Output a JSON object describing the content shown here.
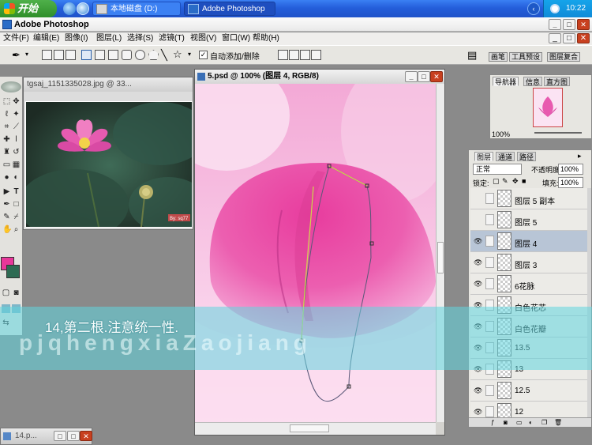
{
  "taskbar": {
    "start_label": "开始",
    "tasks": [
      {
        "label": "本地磁盘 (D:)"
      },
      {
        "label": "Adobe Photoshop"
      }
    ],
    "clock": "10:22"
  },
  "app": {
    "title": "Adobe Photoshop"
  },
  "menu": [
    "文件(F)",
    "编辑(E)",
    "图像(I)",
    "图层(L)",
    "选择(S)",
    "滤镜(T)",
    "视图(V)",
    "窗口(W)",
    "帮助(H)"
  ],
  "options": {
    "auto_add_delete": "自动添加/删除",
    "auto_add_checked": "✓",
    "palette_tabs": [
      "画笔",
      "工具预设",
      "图层复合"
    ]
  },
  "documents": {
    "photo_title": "tgsaj_1151335028.jpg @ 33...",
    "photo_watermark": "By: sq77",
    "main_title": "5.psd @ 100% (图层 4, RGB/8)",
    "minimized_title": "14.p..."
  },
  "navigator": {
    "tabs": [
      "导航器",
      "信息",
      "直方图"
    ],
    "zoom": "100%"
  },
  "layers": {
    "tabs": [
      "图层",
      "通道",
      "路径"
    ],
    "blend_mode": "正常",
    "opacity_label": "不透明度:",
    "opacity": "100%",
    "lock_label": "锁定:",
    "fill_label": "填充:",
    "fill": "100%",
    "items": [
      {
        "name": "图层 5 副本",
        "visible": false,
        "selected": false
      },
      {
        "name": "图层 5",
        "visible": false,
        "selected": false
      },
      {
        "name": "图层 4",
        "visible": true,
        "selected": true
      },
      {
        "name": "图层 3",
        "visible": true,
        "selected": false
      },
      {
        "name": "6花脉",
        "visible": true,
        "selected": false
      },
      {
        "name": "白色花芯",
        "visible": true,
        "selected": false
      },
      {
        "name": "白色花瓣",
        "visible": true,
        "selected": false
      },
      {
        "name": "13.5",
        "visible": true,
        "selected": false
      },
      {
        "name": "13",
        "visible": true,
        "selected": false
      },
      {
        "name": "12.5",
        "visible": true,
        "selected": false
      },
      {
        "name": "12",
        "visible": true,
        "selected": false
      }
    ]
  },
  "caption": {
    "text": "14,第二根.注意统一性.",
    "watermark": "pjqhengxiaZaojiang"
  },
  "colors": {
    "foreground": "#e8379a",
    "background": "#2e6b53",
    "caption_band": "#60d5de"
  }
}
